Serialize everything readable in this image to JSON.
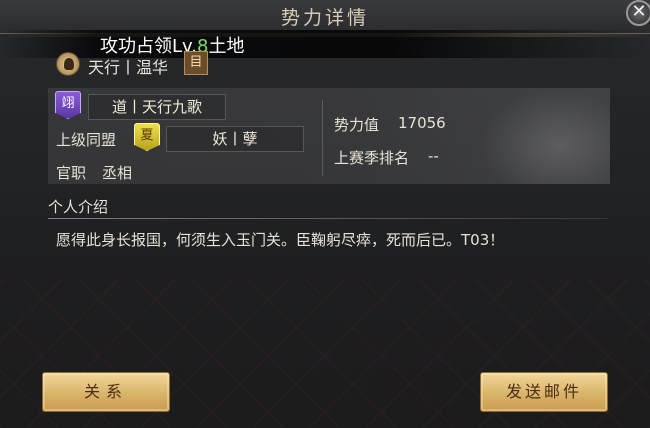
{
  "window": {
    "title": "势力详情",
    "close_label": "✕"
  },
  "toast": {
    "prefix": "攻功占领Lv.",
    "level": "8",
    "suffix": "土地"
  },
  "player": {
    "name": "天行丨温华",
    "doc_icon_glyph": "目"
  },
  "guild": {
    "badge": "翊",
    "name": "道丨天行九歌"
  },
  "alliance": {
    "label": "上级同盟",
    "badge": "夏",
    "name": "妖丨孽"
  },
  "office": {
    "label": "官职",
    "value": "丞相"
  },
  "stats": {
    "power_label": "势力值",
    "power_value": "17056",
    "rank_label": "上赛季排名",
    "rank_value": "--"
  },
  "intro": {
    "header": "个人介绍",
    "text": "愿得此身长报国，何须生入玉门关。臣鞠躬尽瘁，死而后已。T03！"
  },
  "buttons": {
    "relations": "关系",
    "send_mail": "发送邮件"
  },
  "colors": {
    "accent_gold": "#d9b46a",
    "guild_purple": "#8a5cd8",
    "alliance_yellow": "#ece04a",
    "level_green": "#7fdc6e"
  }
}
